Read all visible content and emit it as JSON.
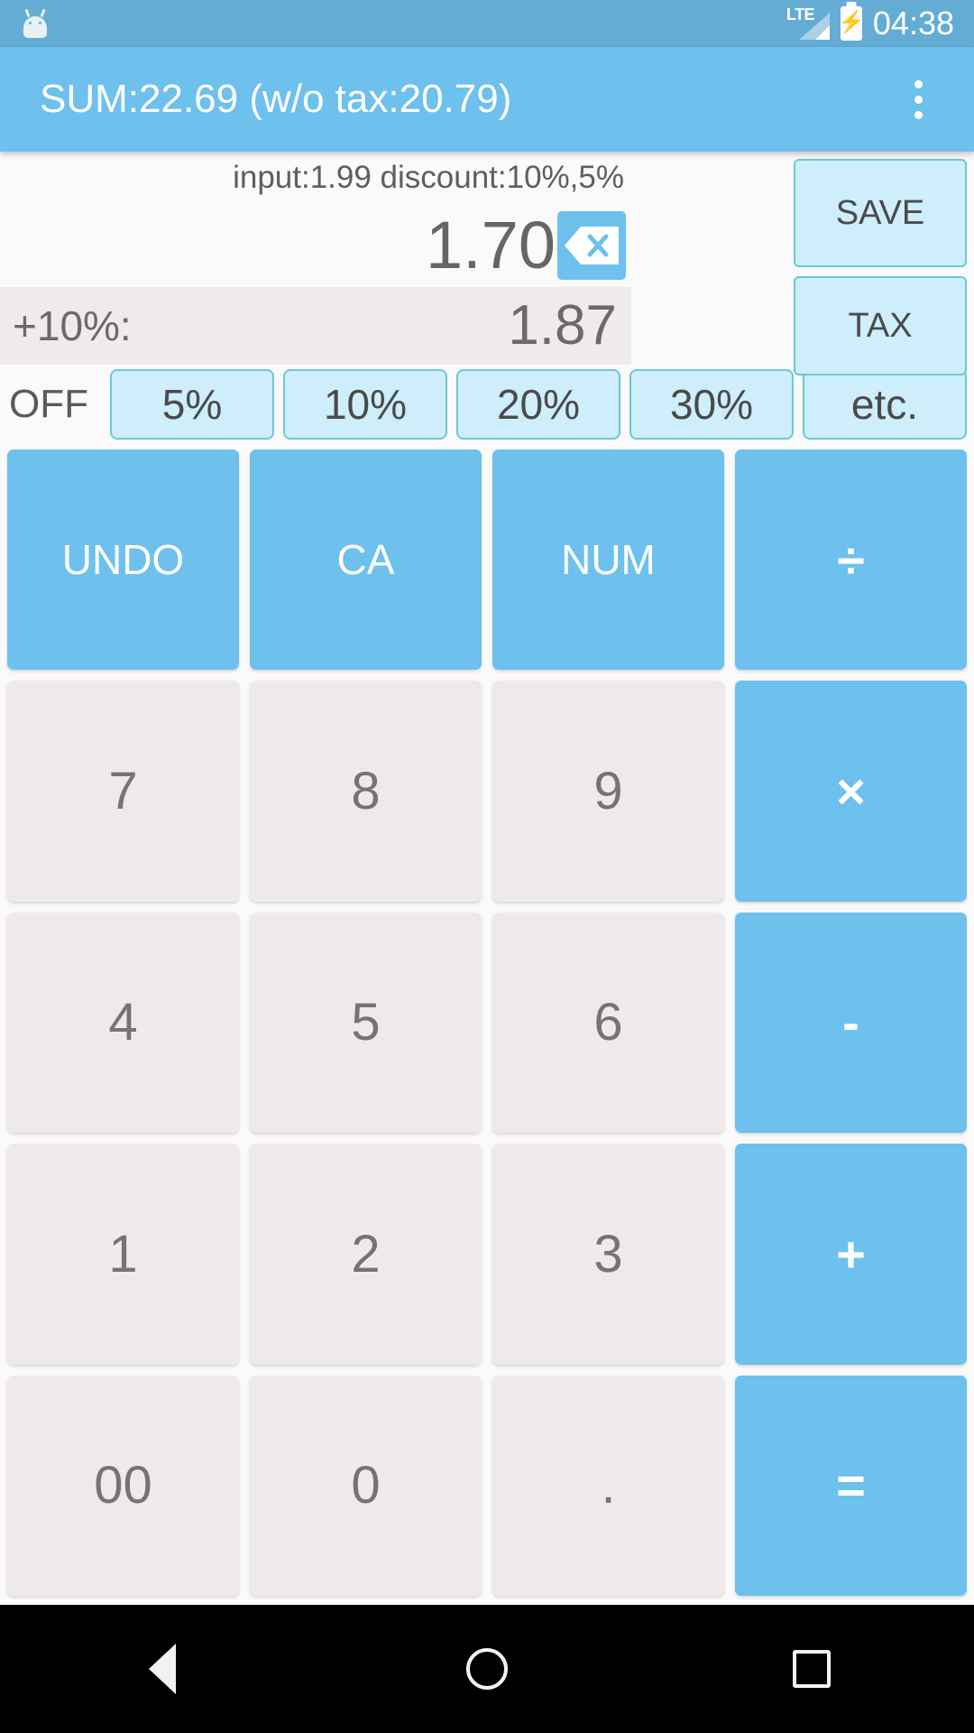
{
  "status_bar": {
    "robot_icon": "android-robot-icon",
    "network_label": "LTE",
    "signal_icon": "signal-bars-icon",
    "battery_icon": "battery-charging-icon",
    "battery_glyph": "⚡",
    "clock": "04:38"
  },
  "app_bar": {
    "title": "SUM:22.69 (w/o tax:20.79)",
    "overflow_icon": "overflow-menu-icon"
  },
  "display": {
    "info_line": "input:1.99  discount:10%,5%",
    "main_value": "1.70",
    "backspace_icon": "backspace-icon",
    "tax_label": "+10%:",
    "tax_value": "1.87"
  },
  "actions": {
    "save_label": "SAVE",
    "tax_label": "TAX"
  },
  "discount_row": {
    "label": "OFF",
    "buttons": [
      {
        "label": "5%",
        "name": "discount-5"
      },
      {
        "label": "10%",
        "name": "discount-10"
      },
      {
        "label": "20%",
        "name": "discount-20"
      },
      {
        "label": "30%",
        "name": "discount-30"
      },
      {
        "label": "etc.",
        "name": "discount-etc"
      }
    ]
  },
  "keypad": {
    "rows": [
      [
        {
          "label": "UNDO",
          "type": "blue",
          "name": "key-undo"
        },
        {
          "label": "CA",
          "type": "blue",
          "name": "key-clear-all"
        },
        {
          "label": "NUM",
          "type": "blue",
          "name": "key-num"
        },
        {
          "label": "÷",
          "type": "op",
          "name": "key-divide"
        }
      ],
      [
        {
          "label": "7",
          "type": "num",
          "name": "key-7"
        },
        {
          "label": "8",
          "type": "num",
          "name": "key-8"
        },
        {
          "label": "9",
          "type": "num",
          "name": "key-9"
        },
        {
          "label": "×",
          "type": "op",
          "name": "key-multiply"
        }
      ],
      [
        {
          "label": "4",
          "type": "num",
          "name": "key-4"
        },
        {
          "label": "5",
          "type": "num",
          "name": "key-5"
        },
        {
          "label": "6",
          "type": "num",
          "name": "key-6"
        },
        {
          "label": "-",
          "type": "op",
          "name": "key-minus"
        }
      ],
      [
        {
          "label": "1",
          "type": "num",
          "name": "key-1"
        },
        {
          "label": "2",
          "type": "num",
          "name": "key-2"
        },
        {
          "label": "3",
          "type": "num",
          "name": "key-3"
        },
        {
          "label": "+",
          "type": "op",
          "name": "key-plus"
        }
      ],
      [
        {
          "label": "00",
          "type": "num",
          "name": "key-double-zero"
        },
        {
          "label": "0",
          "type": "num",
          "name": "key-0"
        },
        {
          "label": ".",
          "type": "num",
          "name": "key-decimal"
        },
        {
          "label": "=",
          "type": "op",
          "name": "key-equals"
        }
      ]
    ]
  },
  "nav_bar": {
    "back_icon": "nav-back-icon",
    "home_icon": "nav-home-icon",
    "recents_icon": "nav-recents-icon"
  },
  "colors": {
    "status_bar": "#64acd4",
    "app_bar": "#6ec0ed",
    "accent_blue": "#6ec0ed",
    "light_cyan": "#cdeefa",
    "cyan_border": "#6ec7d4",
    "num_key": "#efeae9",
    "tax_row": "#f0eaea"
  }
}
